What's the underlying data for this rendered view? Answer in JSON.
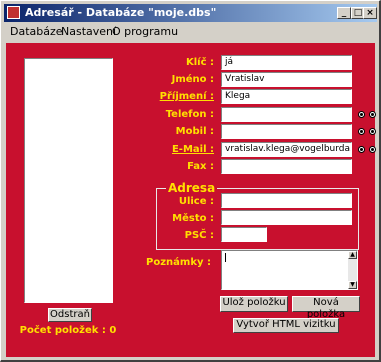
{
  "window": {
    "title": "Adresář - Databáze \"moje.dbs\""
  },
  "menu": [
    "Databáze",
    "Nastavení",
    "O programu"
  ],
  "sidebar": {
    "delete_label": "Odstraň",
    "count_label": "Počet položek : 0"
  },
  "fields": {
    "klic": {
      "label": "Klíč :",
      "value": "já"
    },
    "jmeno": {
      "label": "Jméno :",
      "value": "Vratislav"
    },
    "prijmeni": {
      "label": "Příjmení :",
      "value": "Klega"
    },
    "telefon": {
      "label": "Telefon :",
      "value": ""
    },
    "mobil": {
      "label": "Mobil :",
      "value": ""
    },
    "email": {
      "label": "E-Mail :",
      "value": "vratislav.klega@vogelburda.cz"
    },
    "fax": {
      "label": "Fax :",
      "value": ""
    }
  },
  "address": {
    "legend": "Adresa",
    "ulice": {
      "label": "Ulice :",
      "value": ""
    },
    "mesto": {
      "label": "Město :",
      "value": ""
    },
    "psc": {
      "label": "PSČ :",
      "value": ""
    }
  },
  "notes": {
    "label": "Poznámky :",
    "value": ""
  },
  "buttons": {
    "save": "Ulož položku",
    "new": "Nová položka",
    "html": "Vytvoř HTML vizitku"
  },
  "colors": {
    "panel": "#c8102e",
    "label": "#ffe000",
    "titlebar": "#0a246a"
  }
}
